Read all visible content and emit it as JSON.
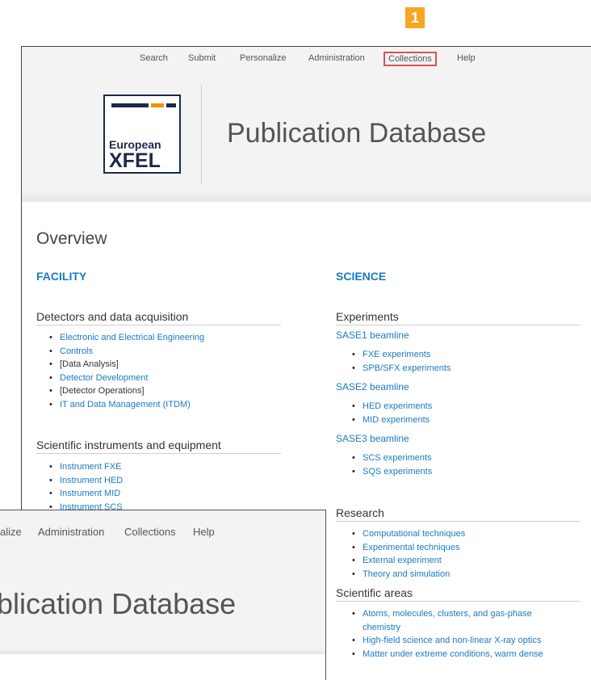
{
  "step_badge": "1",
  "nav": {
    "search": "Search",
    "submit": "Submit",
    "personalize": "Personalize",
    "administration": "Administration",
    "collections": "Collections",
    "help": "Help"
  },
  "logo": {
    "line1": "European",
    "line2": "XFEL"
  },
  "page_title": "Publication Database",
  "overview_heading": "Overview",
  "facility": {
    "heading": "FACILITY",
    "detectors": {
      "title": "Detectors and data acquisition",
      "items": [
        {
          "label": "Electronic and Electrical Engineering",
          "link": true
        },
        {
          "label": "Controls",
          "link": true
        },
        {
          "label": "[Data Analysis]",
          "link": false
        },
        {
          "label": "Detector Development",
          "link": true
        },
        {
          "label": "[Detector Operations]",
          "link": false
        },
        {
          "label": "IT and Data Management (ITDM)",
          "link": true
        }
      ]
    },
    "instruments": {
      "title": "Scientific instruments and equipment",
      "items": [
        "Instrument FXE",
        "Instrument HED",
        "Instrument MID",
        "Instrument SCS"
      ]
    }
  },
  "science": {
    "heading": "SCIENCE",
    "experiments": {
      "title": "Experiments",
      "sase1": {
        "label": "SASE1 beamline",
        "items": [
          "FXE experiments",
          "SPB/SFX experiments"
        ]
      },
      "sase2": {
        "label": "SASE2 beamline",
        "items": [
          "HED experiments",
          "MID experiments"
        ]
      },
      "sase3": {
        "label": "SASE3 beamline",
        "items": [
          "SCS experiments",
          "SQS experiments"
        ]
      }
    },
    "research": {
      "title": "Research",
      "items": [
        "Computational techniques",
        "Experimental techniques",
        "External experiment",
        "Theory and simulation"
      ]
    },
    "areas": {
      "title": "Scientific areas",
      "items": [
        "Atoms, molecules, clusters, and gas-phase",
        "chemistry",
        "High-field science and non-linear X-ray optics",
        "Matter under extreme conditions, warm dense"
      ]
    }
  },
  "overlay": {
    "nav_personalize": "alize",
    "nav_administration": "Administration",
    "nav_collections": "Collections",
    "nav_help": "Help",
    "title": "blication Database"
  }
}
